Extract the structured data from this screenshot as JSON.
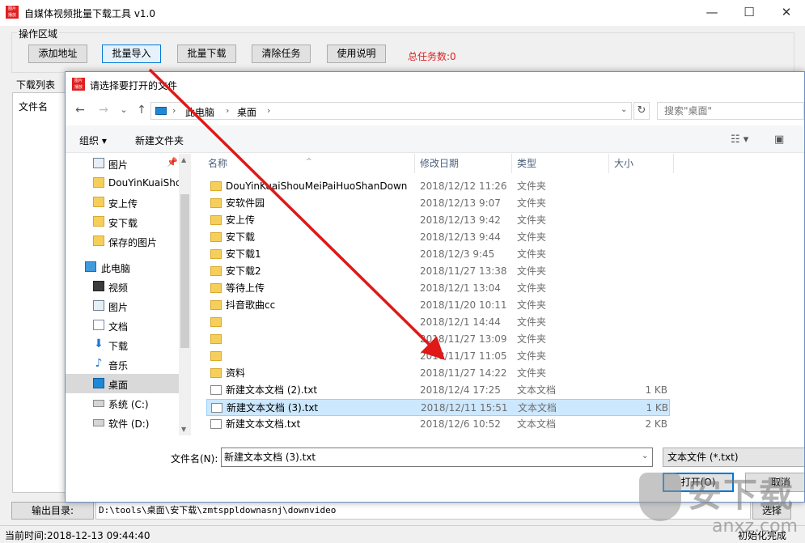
{
  "app": {
    "title": "自媒体视频批量下载工具 v1.0",
    "icon_text": "图片 播放",
    "window_controls": {
      "minimize": "—",
      "maximize": "☐",
      "close": "✕"
    }
  },
  "ops": {
    "legend": "操作区域",
    "buttons": [
      "添加地址",
      "批量导入",
      "批量下载",
      "清除任务",
      "使用说明"
    ],
    "task_count": "总任务数:0"
  },
  "download_list": {
    "legend": "下载列表",
    "column": "文件名"
  },
  "output": {
    "label": "输出目录:",
    "path": "D:\\tools\\桌面\\安下载\\zmtsppldownasnj\\downvideo",
    "choose": "选择"
  },
  "status": {
    "time": "当前时间:2018-12-13 09:44:40",
    "init": "初始化完成"
  },
  "dialog": {
    "title": "请选择要打开的文件",
    "nav": {
      "back": "←",
      "forward": "→",
      "dropdown": "⌄",
      "up": "↑",
      "refresh": "↻"
    },
    "breadcrumb": [
      "此电脑",
      "桌面"
    ],
    "search_placeholder": "搜索\"桌面\"",
    "commands": {
      "organize": "组织 ▾",
      "new_folder": "新建文件夹"
    },
    "nav_items": [
      {
        "label": "图片",
        "icon": "picture-icon"
      },
      {
        "label": "DouYinKuaiShc",
        "icon": "folder-icon"
      },
      {
        "label": "安上传",
        "icon": "folder-icon"
      },
      {
        "label": "安下载",
        "icon": "folder-icon"
      },
      {
        "label": "保存的图片",
        "icon": "folder-icon"
      },
      {
        "label": "此电脑",
        "icon": "computer-icon"
      },
      {
        "label": "视频",
        "icon": "video-icon"
      },
      {
        "label": "图片",
        "icon": "picture-icon"
      },
      {
        "label": "文档",
        "icon": "document-icon"
      },
      {
        "label": "下载",
        "icon": "download-icon"
      },
      {
        "label": "音乐",
        "icon": "music-icon"
      },
      {
        "label": "桌面",
        "icon": "desktop-icon"
      },
      {
        "label": "系统 (C:)",
        "icon": "drive-icon"
      },
      {
        "label": "软件 (D:)",
        "icon": "drive-icon"
      }
    ],
    "columns": [
      "名称",
      "修改日期",
      "类型",
      "大小"
    ],
    "files": [
      {
        "name": "DouYinKuaiShouMeiPaiHuoShanDown",
        "date": "2018/12/12 11:26",
        "type": "文件夹",
        "size": "",
        "kind": "folder"
      },
      {
        "name": "安软件园",
        "date": "2018/12/13 9:07",
        "type": "文件夹",
        "size": "",
        "kind": "folder"
      },
      {
        "name": "安上传",
        "date": "2018/12/13 9:42",
        "type": "文件夹",
        "size": "",
        "kind": "folder"
      },
      {
        "name": "安下载",
        "date": "2018/12/13 9:44",
        "type": "文件夹",
        "size": "",
        "kind": "folder"
      },
      {
        "name": "安下载1",
        "date": "2018/12/3 9:45",
        "type": "文件夹",
        "size": "",
        "kind": "folder"
      },
      {
        "name": "安下载2",
        "date": "2018/11/27 13:38",
        "type": "文件夹",
        "size": "",
        "kind": "folder"
      },
      {
        "name": "等待上传",
        "date": "2018/12/1 13:04",
        "type": "文件夹",
        "size": "",
        "kind": "folder"
      },
      {
        "name": "抖音歌曲cc",
        "date": "2018/11/20 10:11",
        "type": "文件夹",
        "size": "",
        "kind": "folder"
      },
      {
        "name": "",
        "date": "2018/12/1 14:44",
        "type": "文件夹",
        "size": "",
        "kind": "folder"
      },
      {
        "name": "",
        "date": "2018/11/27 13:09",
        "type": "文件夹",
        "size": "",
        "kind": "folder"
      },
      {
        "name": "",
        "date": "2018/11/17 11:05",
        "type": "文件夹",
        "size": "",
        "kind": "folder"
      },
      {
        "name": "资料",
        "date": "2018/11/27 14:22",
        "type": "文件夹",
        "size": "",
        "kind": "folder"
      },
      {
        "name": "新建文本文档 (2).txt",
        "date": "2018/12/4 17:25",
        "type": "文本文档",
        "size": "1 KB",
        "kind": "txt"
      },
      {
        "name": "新建文本文档 (3).txt",
        "date": "2018/12/11 15:51",
        "type": "文本文档",
        "size": "1 KB",
        "kind": "txt"
      },
      {
        "name": "新建文本文档.txt",
        "date": "2018/12/6 10:52",
        "type": "文本文档",
        "size": "2 KB",
        "kind": "txt"
      }
    ],
    "filename_label": "文件名(N):",
    "filename_value": "新建文本文档 (3).txt",
    "filter": "文本文件 (*.txt)",
    "open": "打开(O)",
    "cancel": "取消"
  },
  "watermark": {
    "text": "安下载",
    "sub": "anxz.com",
    "shield_char": "安"
  },
  "colors": {
    "accent": "#0078d7",
    "task_count": "#e02020",
    "arrow": "#e01818",
    "selection": "#cce8ff"
  }
}
